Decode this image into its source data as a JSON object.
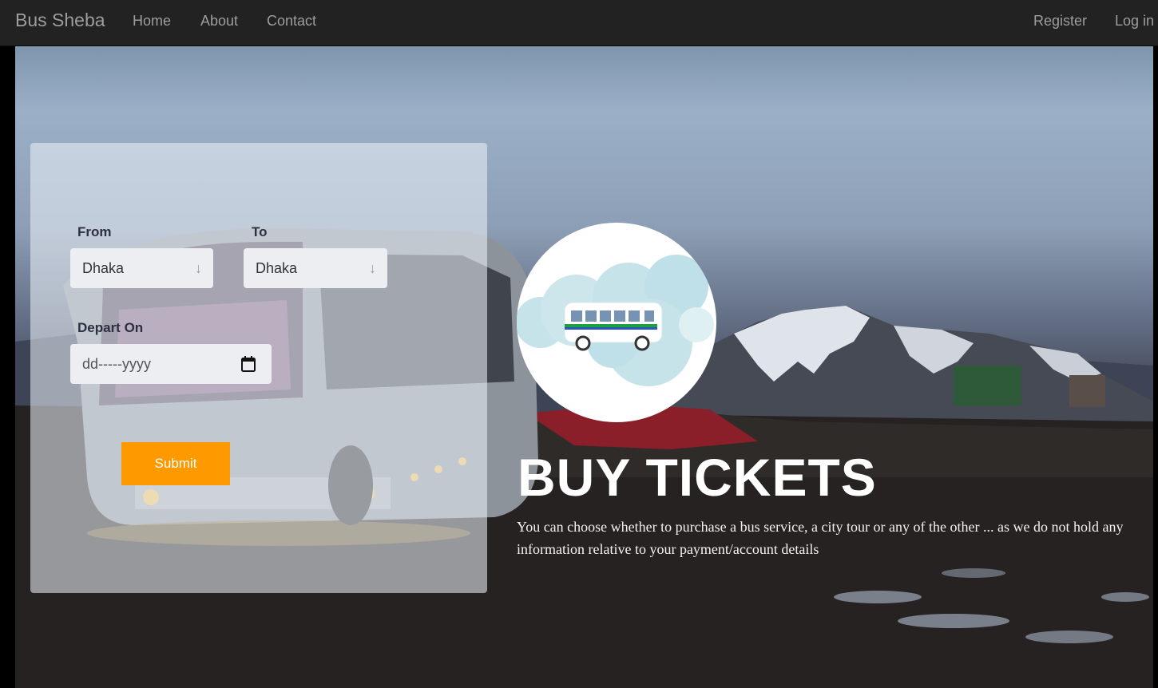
{
  "nav": {
    "brand": "Bus Sheba",
    "links": [
      "Home",
      "About",
      "Contact"
    ],
    "right_links": [
      "Register",
      "Log in"
    ]
  },
  "form": {
    "from_label": "From",
    "from_value": "Dhaka",
    "to_label": "To",
    "to_value": "Dhaka",
    "depart_label": "Depart On",
    "date_placeholder": "dd-----yyyy",
    "submit_label": "Submit"
  },
  "hero": {
    "headline": "BUY TICKETS",
    "description": "You can choose whether to purchase a bus service, a city tour or any of the other ... as we do not hold any information relative to your payment/account details"
  },
  "icons": {
    "select_arrow": "arrow-down-icon",
    "calendar": "calendar-icon",
    "logo": "bus-logo-icon"
  },
  "colors": {
    "navbar_bg": "#222222",
    "nav_text": "#9d9d9d",
    "submit_bg": "#ff9900",
    "headline": "#ffffff"
  }
}
